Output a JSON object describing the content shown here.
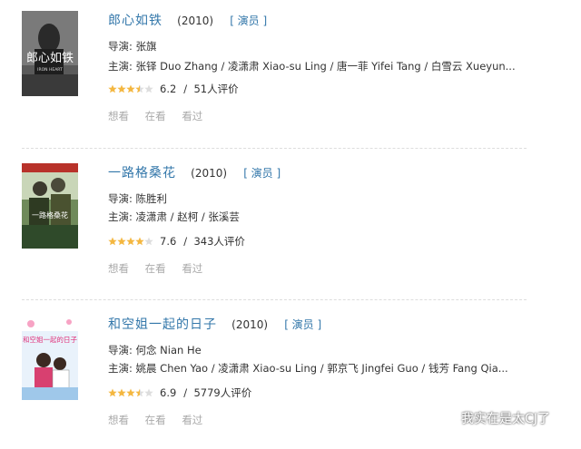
{
  "movies": [
    {
      "title": "郎心如铁",
      "year": "(2010)",
      "role": "[ 演员 ]",
      "director": "导演: 张旗",
      "cast": "主演: 张铎 Duo Zhang / 凌潇肃 Xiao-su Ling / 唐一菲 Yifei Tang / 白雪云 Xueyun...",
      "rating": "6.2",
      "stars": 3.5,
      "votes": "51人评价",
      "actions": [
        "想看",
        "在看",
        "看过"
      ],
      "poster_text": "郎心如铁",
      "poster_sub": "IRON HEART"
    },
    {
      "title": "一路格桑花",
      "year": "(2010)",
      "role": "[ 演员 ]",
      "director": "导演: 陈胜利",
      "cast": "主演: 凌潇肃 / 赵柯 / 张溪芸",
      "rating": "7.6",
      "stars": 4,
      "votes": "343人评价",
      "actions": [
        "想看",
        "在看",
        "看过"
      ],
      "poster_text": "一路格桑花"
    },
    {
      "title": "和空姐一起的日子",
      "year": "(2010)",
      "role": "[ 演员 ]",
      "director": "导演: 何念 Nian He",
      "cast": "主演: 姚晨 Chen Yao / 凌潇肃 Xiao-su Ling / 郭京飞 Jingfei Guo / 钱芳 Fang Qia...",
      "rating": "6.9",
      "stars": 3.5,
      "votes": "5779人评价",
      "actions": [
        "想看",
        "在看",
        "看过"
      ],
      "poster_text": "和空姐一起的日子"
    }
  ],
  "watermark": "我实在是太CJ了",
  "colors": {
    "link": "#3377aa",
    "star": "#f4b740",
    "muted": "#aaaaaa"
  }
}
